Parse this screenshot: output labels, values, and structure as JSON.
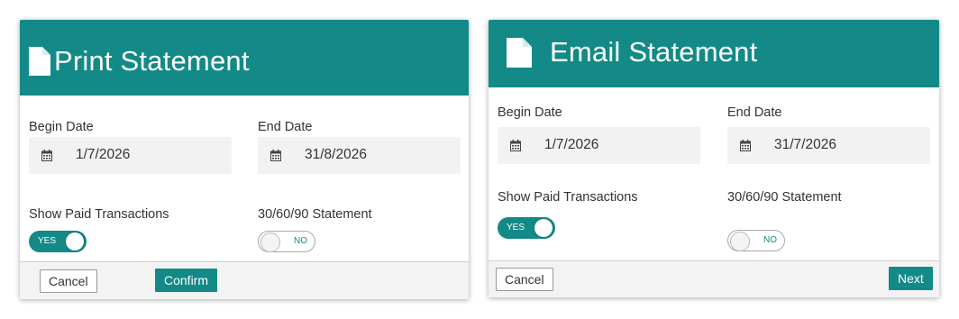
{
  "print_dialog": {
    "title": "Print Statement",
    "icon": "document-icon",
    "begin_date_label": "Begin Date",
    "begin_date_value": "1/7/2026",
    "end_date_label": "End Date",
    "end_date_value": "31/8/2026",
    "show_paid_label": "Show Paid Transactions",
    "show_paid_state": "YES",
    "statement_label": "30/60/90 Statement",
    "statement_state": "NO",
    "cancel_label": "Cancel",
    "confirm_label": "Confirm"
  },
  "email_dialog": {
    "title": "Email Statement",
    "icon": "document-icon",
    "begin_date_label": "Begin Date",
    "begin_date_value": "1/7/2026",
    "end_date_label": "End Date",
    "end_date_value": "31/7/2026",
    "show_paid_label": "Show Paid Transactions",
    "show_paid_state": "YES",
    "statement_label": "30/60/90 Statement",
    "statement_state": "NO",
    "cancel_label": "Cancel",
    "next_label": "Next"
  },
  "colors": {
    "accent": "#138a87",
    "field_bg": "#f2f2f2",
    "footer_bg": "#f3f3f3"
  }
}
